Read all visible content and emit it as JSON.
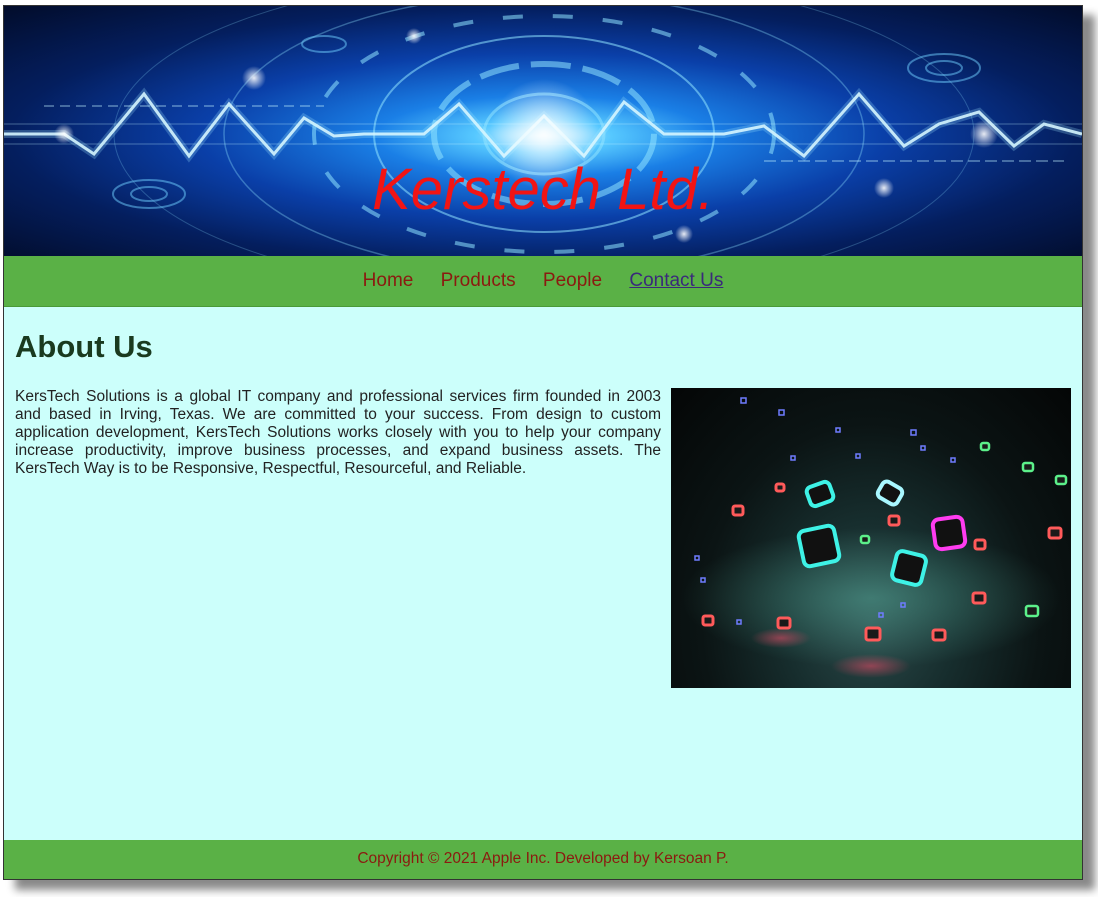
{
  "header": {
    "title": "Kerstech Ltd."
  },
  "nav": {
    "items": [
      {
        "label": "Home"
      },
      {
        "label": "Products"
      },
      {
        "label": "People"
      },
      {
        "label": "Contact Us"
      }
    ]
  },
  "main": {
    "heading": "About Us",
    "paragraph": "KersTech Solutions is a global IT company and professional services firm founded in 2003 and based in Irving, Texas. We are committed to your success. From design to custom application development, KersTech Solutions works closely with you to help your company increase productivity, improve business processes, and expand business assets. The KersTech Way is to be Responsive, Respectful, Resourceful, and Reliable."
  },
  "footer": {
    "text": "Copyright © 2021 Apple Inc. Developed by Kersoan P."
  },
  "colors": {
    "nav_background": "#5ab146",
    "page_background": "#ccfffb",
    "title_color": "#f21414",
    "link_color": "#8b1a10"
  }
}
